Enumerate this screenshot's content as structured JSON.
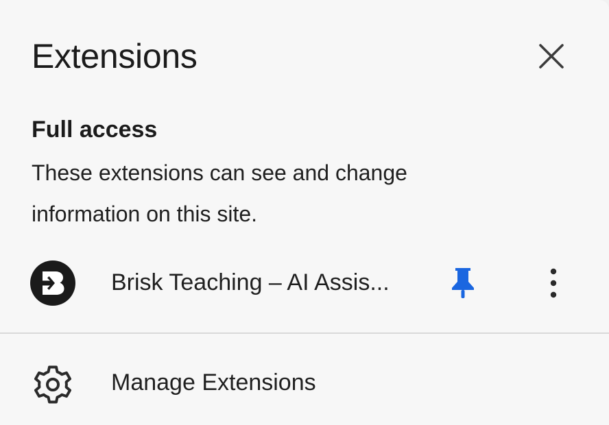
{
  "header": {
    "title": "Extensions",
    "close_icon": "close-icon"
  },
  "full_access": {
    "heading": "Full access",
    "description": "These extensions can see and change information on this site."
  },
  "extensions": [
    {
      "name": "Brisk Teaching – AI Assis...",
      "logo_icon": "brisk-logo-icon",
      "pinned": true,
      "pin_icon": "pin-icon",
      "pin_color": "#1a66e0",
      "menu_icon": "more-vert-icon"
    }
  ],
  "footer": {
    "manage_label": "Manage Extensions",
    "manage_icon": "gear-icon"
  }
}
